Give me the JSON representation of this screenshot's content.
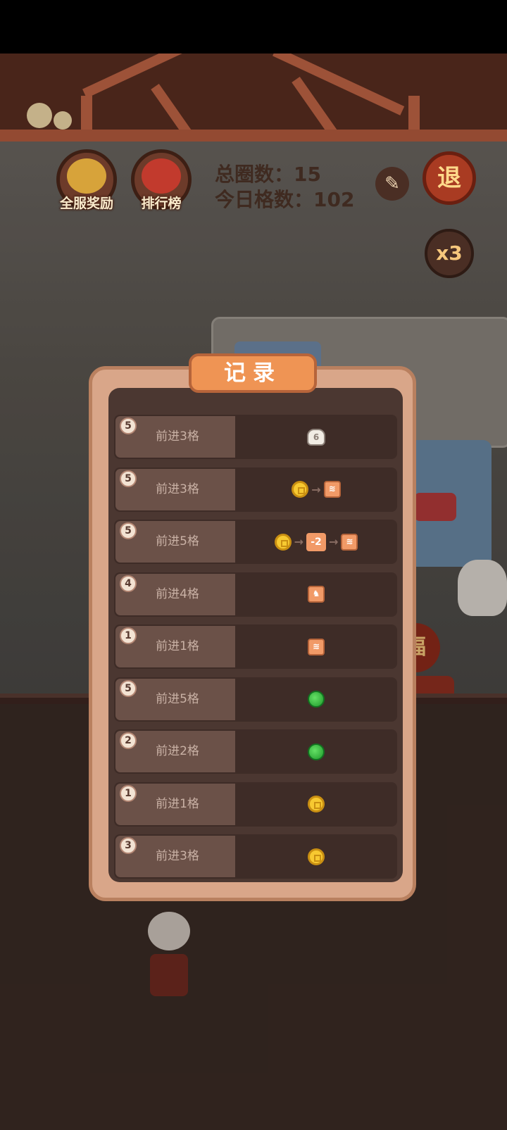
{
  "hud": {
    "server_reward_label": "全服奖励",
    "ranking_label": "排行榜",
    "total_rounds_label": "总圈数：",
    "total_rounds_value": "15",
    "today_steps_label": "今日格数：",
    "today_steps_value": "102",
    "exit_label": "退",
    "multiplier_label": "x3"
  },
  "board": {
    "fu_label": "福"
  },
  "record_panel": {
    "title": "记录",
    "rows": [
      {
        "dice": "5",
        "step": "前进3格",
        "effect": [
          "bag-icon"
        ],
        "bag_label": "6"
      },
      {
        "dice": "5",
        "step": "前进3格",
        "effect": [
          "coin-icon",
          "arrow",
          "wave-tile-icon"
        ]
      },
      {
        "dice": "5",
        "step": "前进5格",
        "effect": [
          "coin-icon",
          "arrow",
          "minus-tile",
          "arrow",
          "wave-tile-icon"
        ],
        "minus_label": "-2"
      },
      {
        "dice": "4",
        "step": "前进4格",
        "effect": [
          "horse-tile-icon"
        ]
      },
      {
        "dice": "1",
        "step": "前进1格",
        "effect": [
          "wave-tile-icon"
        ]
      },
      {
        "dice": "5",
        "step": "前进5格",
        "effect": [
          "green-orb-icon"
        ]
      },
      {
        "dice": "2",
        "step": "前进2格",
        "effect": [
          "green-orb-icon"
        ]
      },
      {
        "dice": "1",
        "step": "前进1格",
        "effect": [
          "coin-icon"
        ]
      },
      {
        "dice": "3",
        "step": "前进3格",
        "effect": [
          "coin-icon"
        ]
      }
    ]
  },
  "colors": {
    "panel_border": "#d9a689",
    "panel_inner": "#4b3731",
    "title_tab": "#ef9454",
    "row_left": "#6b5148",
    "row_right": "#3e2c27"
  }
}
